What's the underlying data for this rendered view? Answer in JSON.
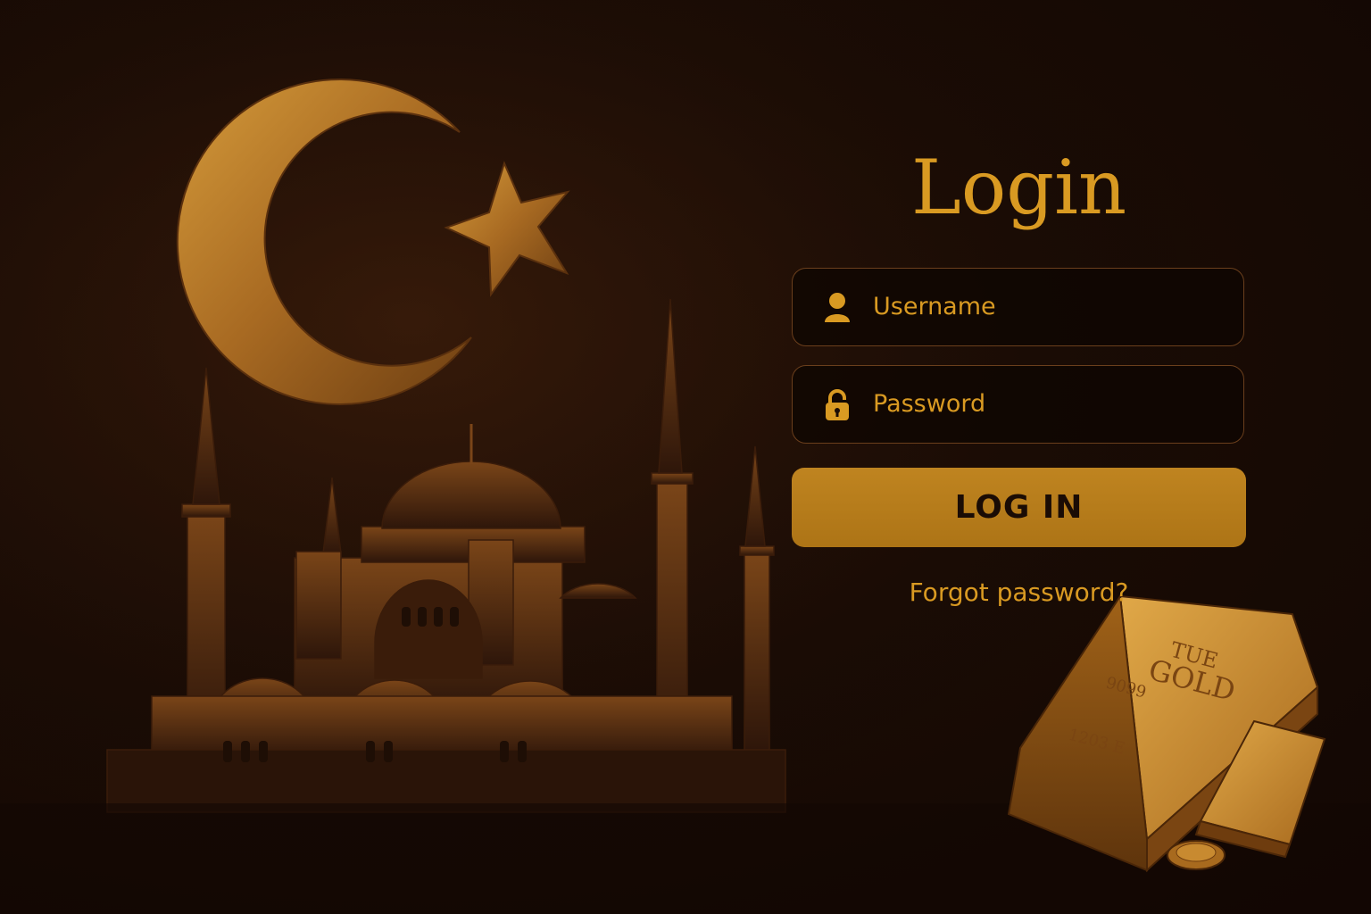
{
  "login": {
    "title": "Login",
    "username_placeholder": "Username",
    "password_placeholder": "Password",
    "login_button": "LOG IN",
    "forgot_password": "Forgot password?"
  },
  "illustration": {
    "gold_bar_engraving": [
      "TUE",
      "GOLD",
      "9099",
      "1203 E"
    ]
  },
  "colors": {
    "accent_gold": "#d99a22",
    "button_gold": "#b87c1c",
    "background": "#1a0c05",
    "field_border": "#6b3f1c"
  },
  "icons": {
    "username": "user-icon",
    "password": "lock-icon"
  }
}
